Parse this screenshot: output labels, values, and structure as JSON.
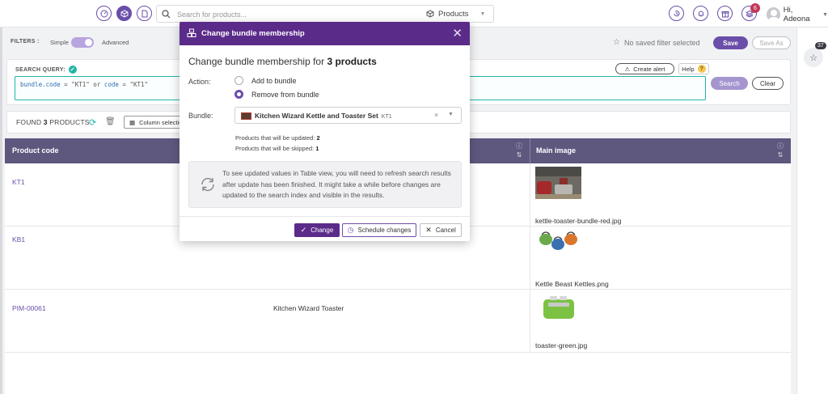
{
  "topbar": {
    "search_placeholder": "Search for products...",
    "search_scope": "Products",
    "notifications_badge": "6",
    "user_greeting": "Hi, Adeona"
  },
  "filters": {
    "label": "FILTERS :",
    "simple": "Simple",
    "advanced": "Advanced",
    "advanced_on": true,
    "saved_filter": "No saved filter selected",
    "save": "Save",
    "save_as": "Save As"
  },
  "query": {
    "label": "SEARCH QUERY:",
    "text_part1": "bundle.code",
    "text_part2": " = \"KT1\" or ",
    "text_part3": "code",
    "text_part4": " = \"KT1\"",
    "create_alert": "Create alert",
    "help": "Help",
    "search": "Search",
    "clear": "Clear"
  },
  "results": {
    "found_prefix": "FOUND ",
    "found_count": "3",
    "found_suffix": " PRODUCTS",
    "column_selector": "Column selection"
  },
  "table": {
    "headers": [
      "Product code",
      "Main image"
    ],
    "rows": [
      {
        "code": "KT1",
        "name": "",
        "image_file": "kettle-toaster-bundle-red.jpg"
      },
      {
        "code": "KB1",
        "name": "",
        "image_file": "Kettle Beast Kettles.png"
      },
      {
        "code": "PIM-00061",
        "name": "Kitchen Wizard Toaster",
        "image_file": "toaster-green.jpg"
      }
    ]
  },
  "favorites": {
    "count": "37"
  },
  "modal": {
    "header": "Change bundle membership",
    "title_prefix": "Change bundle membership for ",
    "title_count": "3 products",
    "action_label": "Action:",
    "options": [
      "Add to bundle",
      "Remove from bundle"
    ],
    "selected_option": "Remove from bundle",
    "bundle_label": "Bundle:",
    "bundle_name": "Kitchen Wizard Kettle and Toaster Set",
    "bundle_code": "KT1",
    "stat_updated_label": "Products that will be updated: ",
    "stat_updated_value": "2",
    "stat_skipped_label": "Products that will be skipped: ",
    "stat_skipped_value": "1",
    "info_text": "To see updated values in Table view, you will need to refresh search results after update has been finished. It might take a while before changes are updated to the search index and visible in the results.",
    "btn_change": "Change",
    "btn_schedule": "Schedule changes",
    "btn_cancel": "Cancel"
  },
  "colors": {
    "brand": "#6a4ea8",
    "modal_header": "#5b2b8a",
    "table_header": "#5e587f",
    "accent_teal": "#21b4a8"
  }
}
